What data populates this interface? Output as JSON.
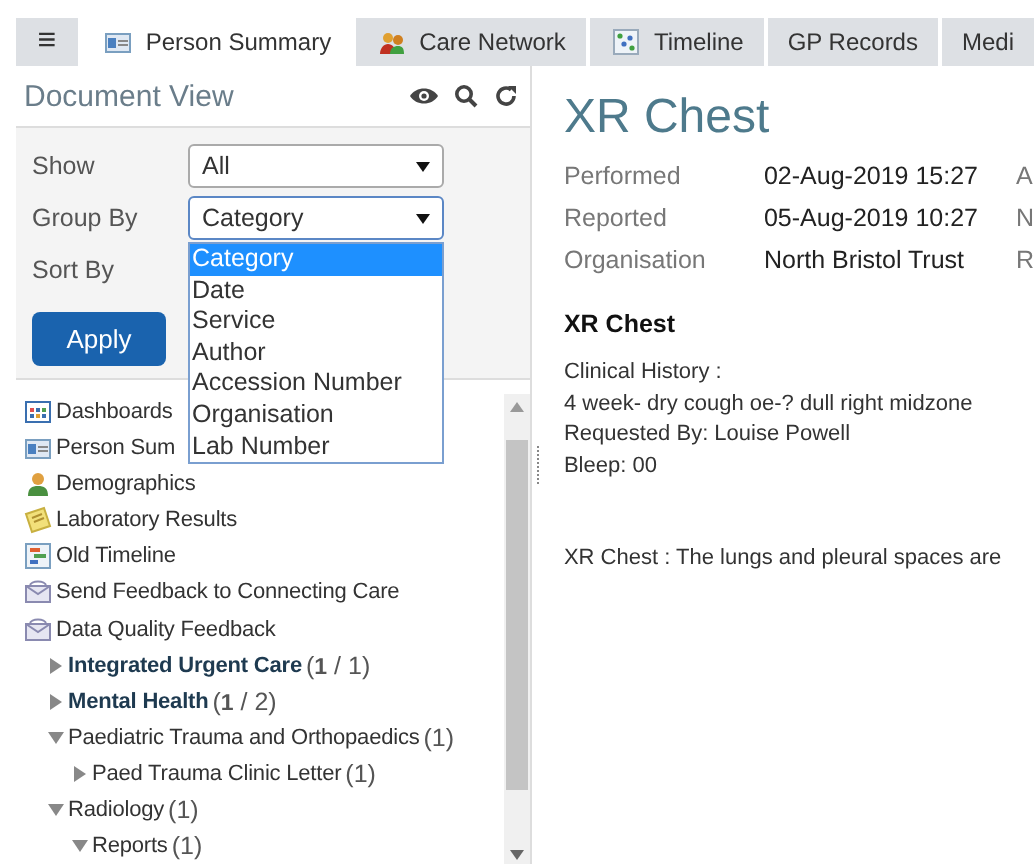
{
  "menu_button": {
    "label": "≡"
  },
  "tabs": [
    {
      "label": "Person Summary",
      "selected": true
    },
    {
      "label": "Care Network",
      "selected": false
    },
    {
      "label": "Timeline",
      "selected": false
    },
    {
      "label": "GP Records",
      "selected": false
    },
    {
      "label": "Medi",
      "selected": false
    }
  ],
  "sidebar": {
    "title": "Document View",
    "filters": [
      {
        "label": "Show",
        "value": "All",
        "open": false
      },
      {
        "label": "Group By",
        "value": "Category",
        "open": true
      },
      {
        "label": "Sort By"
      }
    ],
    "dropdown_options": [
      {
        "label": "Category",
        "selected": true
      },
      {
        "label": "Date",
        "selected": false
      },
      {
        "label": "Service",
        "selected": false
      },
      {
        "label": "Author",
        "selected": false
      },
      {
        "label": "Accession Number",
        "selected": false
      },
      {
        "label": "Organisation",
        "selected": false
      },
      {
        "label": "Lab Number",
        "selected": false
      }
    ],
    "apply_button": "Apply",
    "tree": [
      {
        "kind": "link",
        "label": "Dashboards"
      },
      {
        "kind": "link",
        "label": "Person Sum"
      },
      {
        "kind": "link",
        "label": "Demographics"
      },
      {
        "kind": "link",
        "label": "Laboratory Results"
      },
      {
        "kind": "link",
        "label": "Old Timeline"
      },
      {
        "kind": "link",
        "label": "Send Feedback to Connecting Care"
      },
      {
        "kind": "link",
        "label": "Data Quality Feedback"
      },
      {
        "kind": "group",
        "label": "Integrated Urgent Care",
        "count": "(**1** / 1)",
        "bold": true,
        "expanded": false
      },
      {
        "kind": "group",
        "label": "Mental Health",
        "count": "(**1** / 2)",
        "bold": true,
        "expanded": false
      },
      {
        "kind": "group",
        "label": "Paediatric Trauma and Orthopaedics",
        "count": "(1)",
        "bold": false,
        "expanded": true,
        "children": [
          {
            "kind": "group",
            "label": "Paed Trauma Clinic Letter",
            "count": "(1)",
            "bold": false,
            "expanded": false
          }
        ]
      },
      {
        "kind": "group",
        "label": "Radiology",
        "count": "(1)",
        "bold": false,
        "expanded": true,
        "children": [
          {
            "kind": "group",
            "label": "Reports",
            "count": "(1)",
            "bold": false,
            "expanded": true
          }
        ]
      }
    ]
  },
  "document": {
    "title": "XR Chest",
    "meta": [
      {
        "label": "Performed",
        "value": "02-Aug-2019 15:27"
      },
      {
        "label": "Reported",
        "value": "05-Aug-2019 10:27"
      },
      {
        "label": "Organisation",
        "value": "North Bristol Trust"
      }
    ],
    "column_3": [
      "A",
      "N",
      "R"
    ],
    "heading": "XR Chest",
    "lines": [
      "Clinical History :",
      "4 week- dry cough oe-? dull right midzone",
      "Requested By: Louise Powell",
      "Bleep: 00"
    ],
    "report": "XR Chest : The lungs and pleural spaces are"
  }
}
